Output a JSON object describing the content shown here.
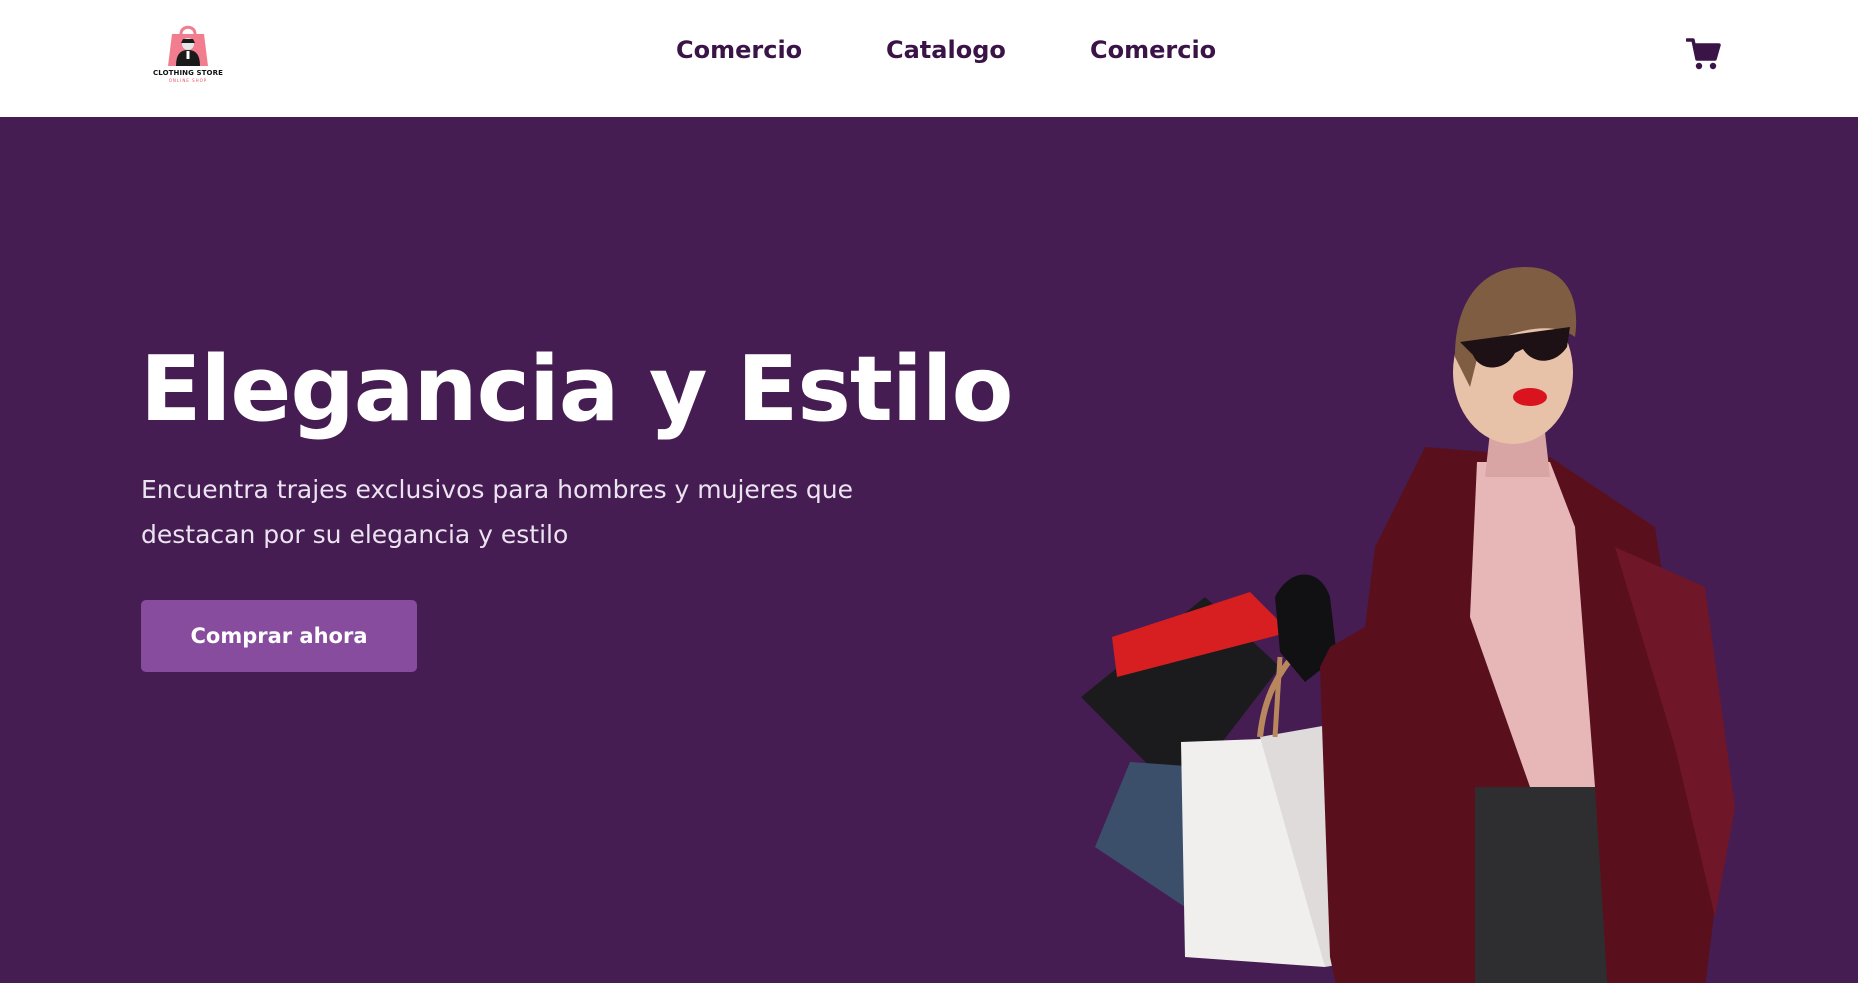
{
  "brand": {
    "name": "CLOTHING STORE",
    "tagline": "ONLINE SHOP",
    "colors": {
      "primary": "#451d52",
      "accent": "#874c9e",
      "nav_text": "#3a1447",
      "logo_pink": "#f27d8f"
    }
  },
  "nav": {
    "items": [
      {
        "label": "Comercio"
      },
      {
        "label": "Catalogo"
      },
      {
        "label": "Comercio"
      }
    ],
    "cart_icon": "shopping-cart-icon"
  },
  "hero": {
    "title": "Elegancia y Estilo",
    "subtitle": "Encuentra trajes exclusivos para hombres y mujeres que destacan por su elegancia y estilo",
    "cta_label": "Comprar ahora"
  }
}
